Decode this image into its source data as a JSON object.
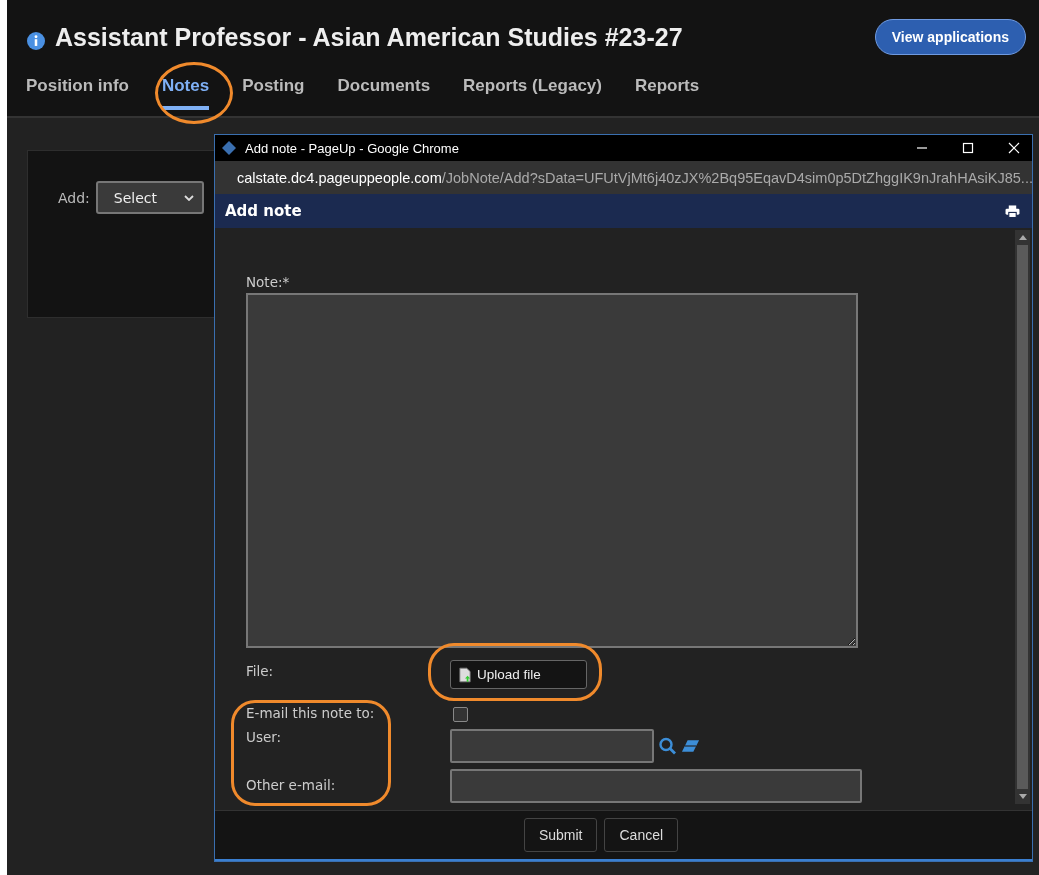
{
  "page": {
    "title": "Assistant Professor - Asian American Studies #23-27",
    "view_button": "View applications",
    "tabs": [
      {
        "label": "Position info",
        "selected": false
      },
      {
        "label": "Notes",
        "selected": true
      },
      {
        "label": "Posting",
        "selected": false
      },
      {
        "label": "Documents",
        "selected": false
      },
      {
        "label": "Reports (Legacy)",
        "selected": false
      },
      {
        "label": "Reports",
        "selected": false
      }
    ]
  },
  "add_panel": {
    "label": "Add:",
    "select_value": "Select"
  },
  "popup": {
    "window_title": "Add note - PageUp - Google Chrome",
    "url_host": "calstate.dc4.pageuppeople.com",
    "url_path": "/JobNote/Add?sData=UFUtVjMt6j40zJX%2Bq95EqavD4sim0p5DtZhggIK9nJrahHAsiKJ85...",
    "heading": "Add note",
    "note_label": "Note:*",
    "file_label": "File:",
    "upload_button": "Upload file",
    "email_label": "E-mail this note to:",
    "email_checked": false,
    "user_label": "User:",
    "other_email_label": "Other e-mail:",
    "buttons": [
      "Submit",
      "Cancel"
    ]
  }
}
